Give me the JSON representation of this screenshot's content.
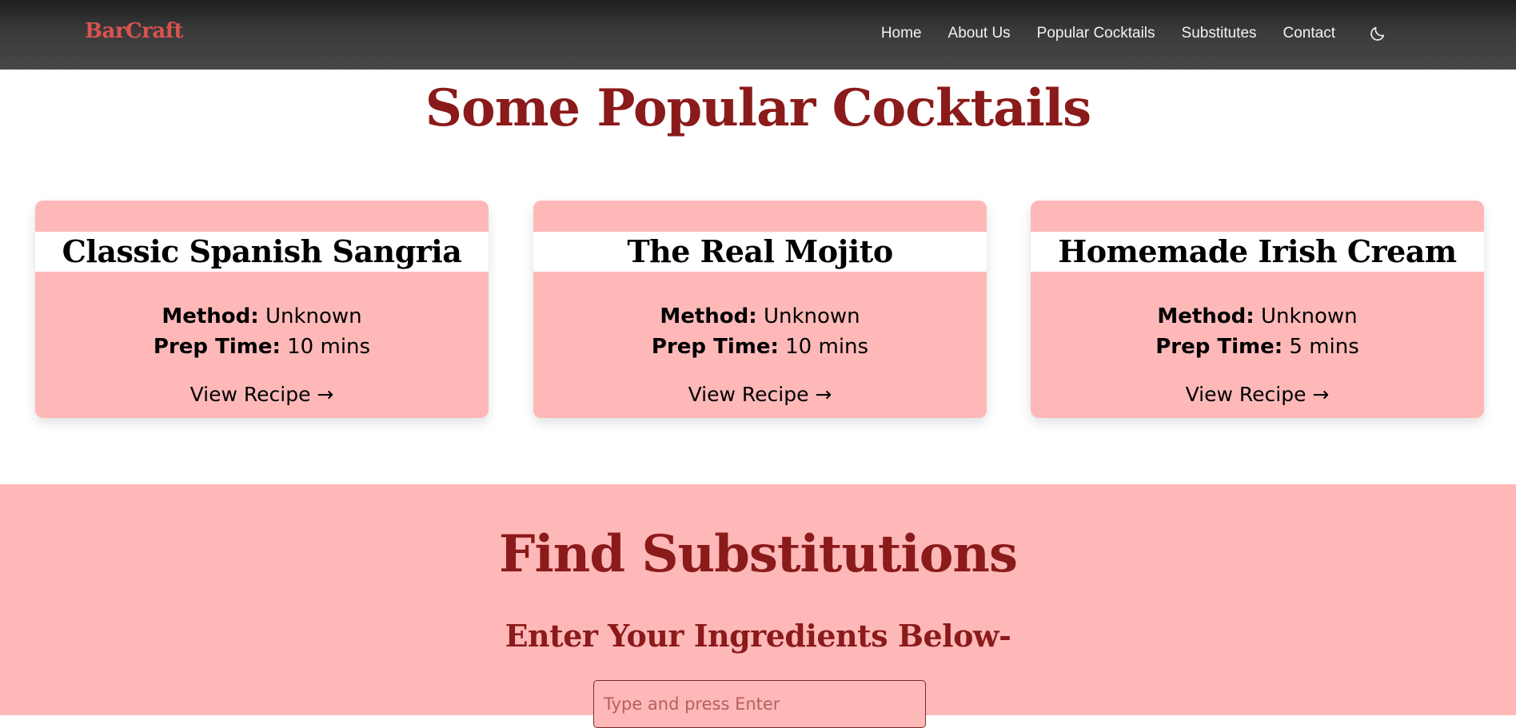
{
  "navbar": {
    "brand": "BarCraft",
    "links": [
      "Home",
      "About Us",
      "Popular Cocktails",
      "Substitutes",
      "Contact"
    ],
    "theme_icon": "moon-icon"
  },
  "popular": {
    "title": "Some Popular Cocktails",
    "cards": [
      {
        "name": "Classic Spanish Sangria",
        "method_label": "Method:",
        "method": "Unknown",
        "prep_label": "Prep Time:",
        "prep": "10 mins",
        "link": "View Recipe →"
      },
      {
        "name": "The Real Mojito",
        "method_label": "Method:",
        "method": "Unknown",
        "prep_label": "Prep Time:",
        "prep": "10 mins",
        "link": "View Recipe →"
      },
      {
        "name": "Homemade Irish Cream",
        "method_label": "Method:",
        "method": "Unknown",
        "prep_label": "Prep Time:",
        "prep": "5 mins",
        "link": "View Recipe →"
      }
    ]
  },
  "substitutions": {
    "title": "Find Substitutions",
    "subtitle": "Enter Your Ingredients Below-",
    "input_placeholder": "Type and press Enter",
    "input_value": ""
  },
  "colors": {
    "brand": "#d9534f",
    "heading": "#8b1a1a",
    "card_bg": "#feb8b8",
    "nav_bg": "#3a3a3a"
  }
}
